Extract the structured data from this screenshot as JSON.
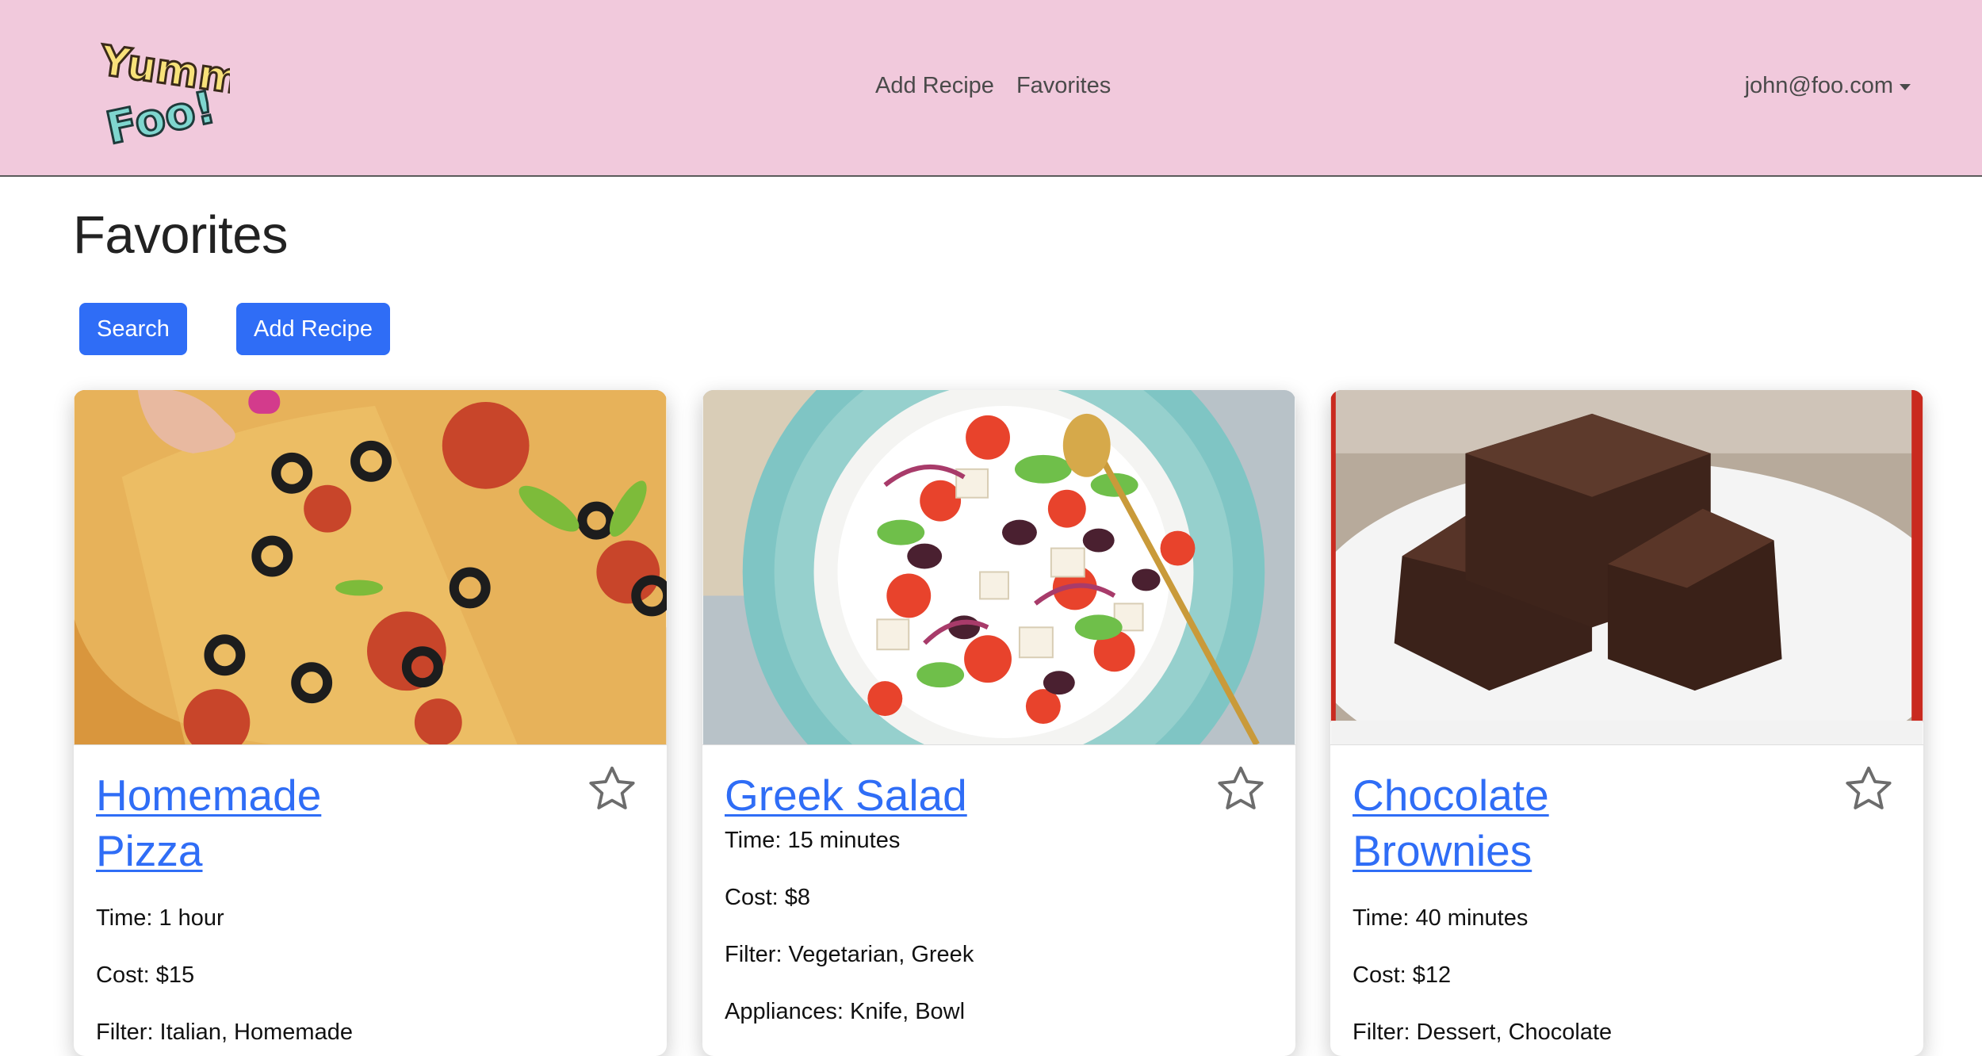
{
  "header": {
    "logo_text": "Yummy Foo!",
    "nav": [
      "Add Recipe",
      "Favorites"
    ],
    "user": "john@foo.com"
  },
  "page": {
    "title": "Favorites",
    "buttons": {
      "search": "Search",
      "add_recipe": "Add Recipe"
    }
  },
  "cards": [
    {
      "title": "Homemade Pizza",
      "time": "Time: 1 hour",
      "cost": "Cost: $15",
      "filter": "Filter: Italian, Homemade",
      "image": "pizza-photo"
    },
    {
      "title": "Greek Salad",
      "time": "Time: 15 minutes",
      "cost": "Cost: $8",
      "filter": "Filter: Vegetarian, Greek",
      "appliances": "Appliances: Knife, Bowl",
      "image": "salad-photo"
    },
    {
      "title": "Chocolate Brownies",
      "time": "Time: 40 minutes",
      "cost": "Cost: $12",
      "filter": "Filter: Dessert, Chocolate",
      "image": "brownie-photo"
    }
  ],
  "colors": {
    "navbar": "#f1c9dc",
    "primary": "#2f6df6",
    "link": "#2f6df6"
  }
}
